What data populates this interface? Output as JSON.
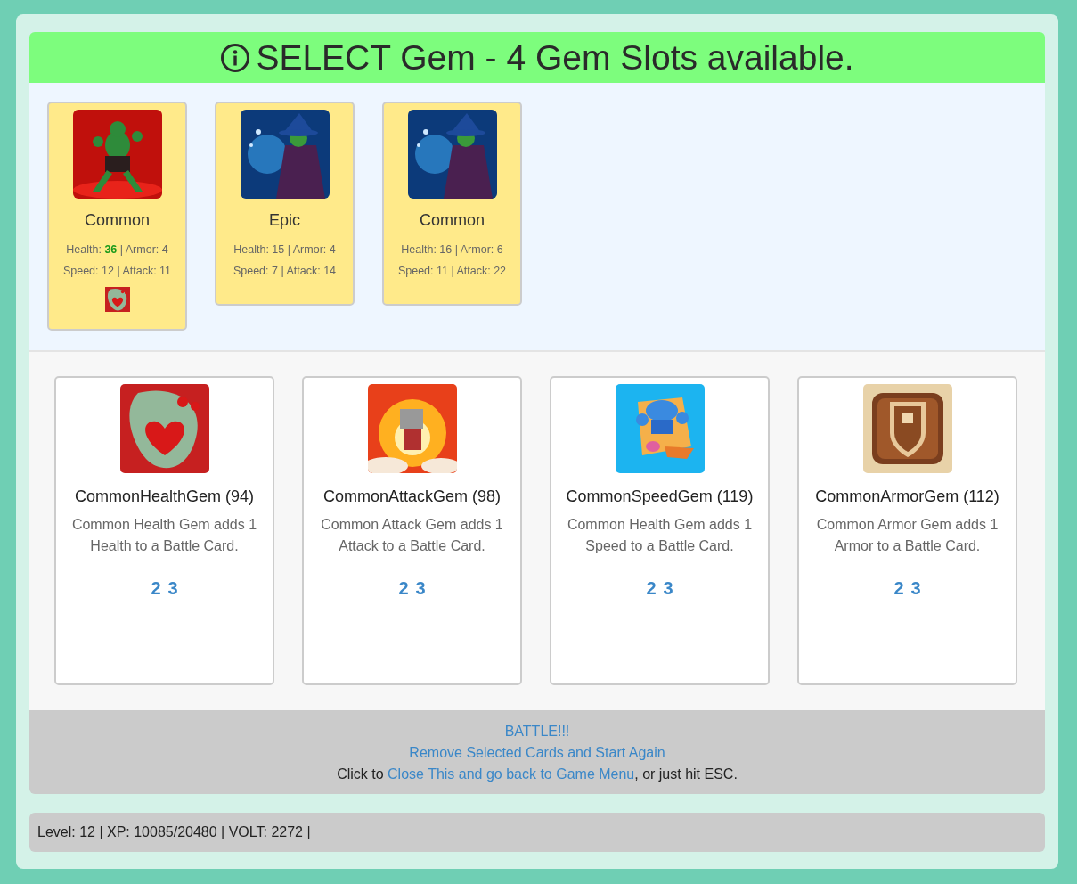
{
  "header": {
    "title": "SELECT Gem - 4 Gem Slots available."
  },
  "battle_cards": [
    {
      "picture": {
        "kind": "picture"
      },
      "rarity": "Common",
      "stats": [
        "Health: **36** | Armor: 4",
        "Speed: 12 | Attack: 11"
      ],
      "equipped_gems": [
        {
          "kind": "picture"
        }
      ]
    },
    {
      "picture": {
        "kind": "picture"
      },
      "rarity": "Epic",
      "stats": [
        "Health: 15 | Armor: 4",
        "Speed: 7 | Attack: 14"
      ]
    },
    {
      "picture": {
        "kind": "picture"
      },
      "rarity": "Common",
      "stats": [
        "Health: 16 | Armor: 6",
        "Speed: 11 | Attack: 22"
      ]
    }
  ],
  "gems": [
    {
      "picture": {
        "kind": "picture"
      },
      "name": "CommonHealthGem (94)",
      "description": "Common Health Gem adds 1 Health to a Battle Card.",
      "options": [
        "2",
        "3"
      ]
    },
    {
      "picture": {
        "kind": "picture"
      },
      "name": "CommonAttackGem (98)",
      "description": "Common Attack Gem adds 1 Attack to a Battle Card.",
      "options": [
        "2",
        "3"
      ]
    },
    {
      "picture": {
        "kind": "picture"
      },
      "name": "CommonSpeedGem (119)",
      "description": "Common Health Gem adds 1 Speed to a Battle Card.",
      "options": [
        "2",
        "3"
      ]
    },
    {
      "picture": {
        "kind": "picture"
      },
      "name": "CommonArmorGem (112)",
      "description": "Common Armor Gem adds 1 Armor to a Battle Card.",
      "options": [
        "2",
        "3"
      ]
    }
  ],
  "footer": {
    "battle_link": "BATTLE!!!",
    "remove_link": "Remove Selected Cards and Start Again",
    "close_line": {
      "before": "Click to ",
      "link": "Close This and go back to Game Menu",
      "after": ", or just hit ESC."
    }
  },
  "status_bar": {
    "text": "Level: 12 | XP: 10085/20480 | VOLT: 2272 |"
  }
}
